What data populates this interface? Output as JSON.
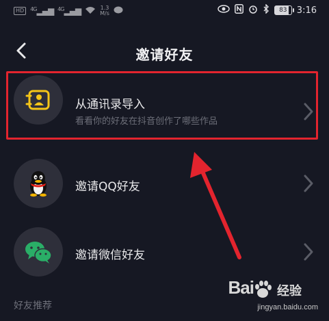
{
  "statusbar": {
    "hd": "HD",
    "signal1": "4G",
    "signal2": "4G",
    "speed_value": "1.3",
    "speed_unit": "M/s",
    "battery": "83",
    "time": "3:16"
  },
  "header": {
    "title": "邀请好友"
  },
  "rows": [
    {
      "label": "从通讯录导入",
      "sub": "看看你的好友在抖音创作了哪些作品",
      "icon": "contacts-icon"
    },
    {
      "label": "邀请QQ好友",
      "icon": "qq-icon"
    },
    {
      "label": "邀请微信好友",
      "icon": "wechat-icon"
    }
  ],
  "section": {
    "recommend": "好友推荐"
  },
  "watermark": {
    "brand": "Bai",
    "brand2": "经验",
    "url": "jingyan.baidu.com"
  },
  "colors": {
    "background": "#161823",
    "highlight": "#e3242e",
    "contacts_icon": "#f5c518",
    "wechat": "#2aae67"
  }
}
